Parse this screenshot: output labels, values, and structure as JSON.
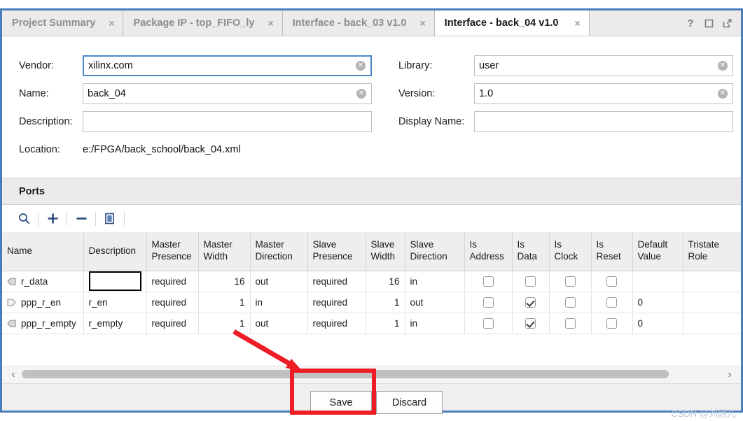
{
  "window": {
    "controls": [
      {
        "name": "help-icon",
        "glyph": "?"
      },
      {
        "name": "maximize-icon",
        "glyph": "□"
      },
      {
        "name": "float-icon",
        "glyph": "⇱"
      }
    ]
  },
  "tabs": [
    {
      "label": "Project Summary",
      "close": "×",
      "active": false
    },
    {
      "label": "Package IP - top_FIFO_ly",
      "close": "×",
      "active": false
    },
    {
      "label": "Interface - back_03 v1.0",
      "close": "×",
      "active": false
    },
    {
      "label": "Interface - back_04 v1.0",
      "close": "×",
      "active": true
    }
  ],
  "form": {
    "vendor": {
      "label": "Vendor:",
      "value": "xilinx.com",
      "clear": "✕"
    },
    "name": {
      "label": "Name:",
      "value": "back_04",
      "clear": "✕"
    },
    "description": {
      "label": "Description:",
      "value": "",
      "placeholder": ""
    },
    "location": {
      "label": "Location:",
      "value": "e:/FPGA/back_school/back_04.xml"
    },
    "library": {
      "label": "Library:",
      "value": "user",
      "clear": "✕"
    },
    "version": {
      "label": "Version:",
      "value": "1.0",
      "clear": "✕"
    },
    "display_name": {
      "label": "Display Name:",
      "value": "",
      "placeholder": ""
    }
  },
  "ports_section": {
    "title": "Ports",
    "toolbar": [
      {
        "name": "search-icon",
        "tooltip": "Search"
      },
      {
        "name": "add-icon",
        "tooltip": "Add"
      },
      {
        "name": "remove-icon",
        "tooltip": "Remove"
      },
      {
        "name": "copy-icon",
        "tooltip": "Copy"
      }
    ]
  },
  "table": {
    "columns": [
      "Name",
      "Description",
      "Master Presence",
      "Master Width",
      "Master Direction",
      "Slave Presence",
      "Slave Width",
      "Slave Direction",
      "Is Address",
      "Is Data",
      "Is Clock",
      "Is Reset",
      "Default Value",
      "Tristate Role"
    ],
    "rows": [
      {
        "direction_icon": "output-port-icon",
        "name": "r_data",
        "description": "",
        "description_editing": true,
        "master_presence": "required",
        "master_width": "16",
        "master_direction": "out",
        "slave_presence": "required",
        "slave_width": "16",
        "slave_direction": "in",
        "is_address": false,
        "is_data": false,
        "is_clock": false,
        "is_reset": false,
        "default_value": "",
        "tristate_role": ""
      },
      {
        "direction_icon": "input-port-icon",
        "name": "ppp_r_en",
        "description": "r_en",
        "description_editing": false,
        "master_presence": "required",
        "master_width": "1",
        "master_direction": "in",
        "slave_presence": "required",
        "slave_width": "1",
        "slave_direction": "out",
        "is_address": false,
        "is_data": true,
        "is_clock": false,
        "is_reset": false,
        "default_value": "0",
        "tristate_role": ""
      },
      {
        "direction_icon": "output-port-icon",
        "name": "ppp_r_empty",
        "description": "r_empty",
        "description_editing": false,
        "master_presence": "required",
        "master_width": "1",
        "master_direction": "out",
        "slave_presence": "required",
        "slave_width": "1",
        "slave_direction": "in",
        "is_address": false,
        "is_data": true,
        "is_clock": false,
        "is_reset": false,
        "default_value": "0",
        "tristate_role": ""
      }
    ]
  },
  "scrollbar": {
    "left_arrow": "‹",
    "right_arrow": "›"
  },
  "buttons": {
    "save": "Save",
    "discard": "Discard"
  },
  "annotations": {
    "highlight_color": "#ee1c25",
    "arrow_color": "#ee1c25",
    "highlight_target": "save-button",
    "arrow_target": "horizontal-scrollbar"
  },
  "watermark": "CSDN @刘颜儿"
}
